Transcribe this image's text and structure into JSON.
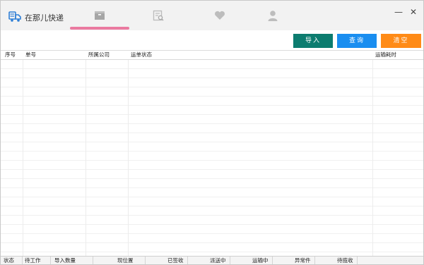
{
  "app": {
    "title": "在那儿快递",
    "accent_color": "#ea7aa0",
    "icons": [
      "truck-logo-icon",
      "box-icon",
      "search-document-icon",
      "heart-icon",
      "user-icon",
      "minimize-icon",
      "close-icon"
    ]
  },
  "window_controls": {
    "minimize": "—",
    "close": "✕"
  },
  "toolbar": {
    "import_label": "导入",
    "query_label": "查询",
    "clear_label": "清空",
    "import_color": "#0c7c6f",
    "query_color": "#1a8ef0",
    "clear_color": "#ff8b17"
  },
  "table": {
    "columns": [
      "序号",
      "单号",
      "所属公司",
      "运单状态",
      "运输耗时"
    ],
    "rows": []
  },
  "status": {
    "state_label": "状态",
    "pending_label": "待工作",
    "import_count_label": "导入数量",
    "import_count_value": "",
    "position_label": "现位置",
    "signed_label": "已签收",
    "delivering_label": "派送中",
    "in_transit_label": "运输中",
    "abnormal_label": "异常件",
    "to_collect_label": "待揽收"
  }
}
